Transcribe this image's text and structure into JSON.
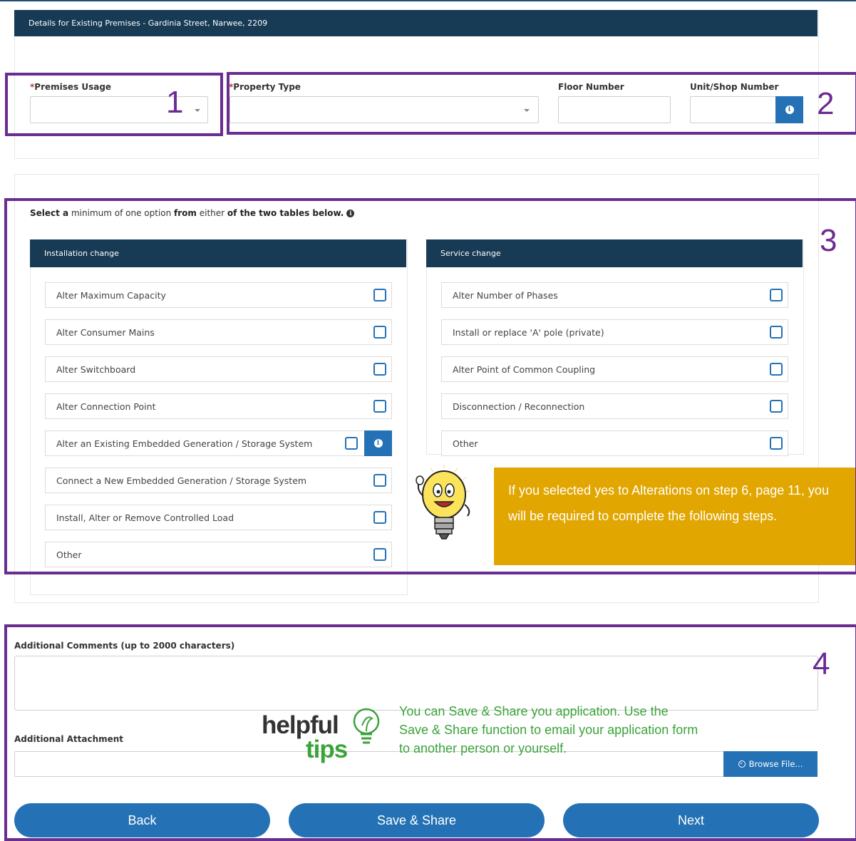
{
  "header": {
    "title": "Details for Existing Premises - Gardinia Street, Narwee, 2209"
  },
  "premises": {
    "usage_label": "Premises Usage",
    "property_type_label": "Property Type",
    "floor_label": "Floor Number",
    "unit_label": "Unit/Shop Number",
    "required_mark": "*"
  },
  "annotations": [
    "1",
    "2",
    "3",
    "4"
  ],
  "selection": {
    "instruction_parts": [
      "Select a",
      " minimum of one option ",
      "from",
      " either ",
      "of the two tables below."
    ],
    "info_glyph": "i"
  },
  "installation": {
    "title": "Installation change",
    "options": [
      "Alter Maximum Capacity",
      "Alter Consumer Mains",
      "Alter Switchboard",
      "Alter Connection Point",
      "Alter an Existing Embedded Generation / Storage System",
      "Connect a New Embedded Generation / Storage System",
      "Install, Alter or Remove Controlled Load",
      "Other"
    ]
  },
  "service": {
    "title": "Service change",
    "options": [
      "Alter Number of Phases",
      "Install or replace 'A' pole (private)",
      "Alter Point of Common Coupling",
      "Disconnection / Reconnection",
      "Other"
    ]
  },
  "callout": {
    "text": "If you selected yes to Alterations on step 6, page 11, you will be required to complete the following steps."
  },
  "comments": {
    "label": "Additional Comments (up to 2000 characters)"
  },
  "attachment": {
    "label": "Additional Attachment",
    "browse_label": "Browse File..."
  },
  "tips": {
    "word1": "helpful",
    "word2": "tips",
    "text": "You can Save & Share you application. Use the Save & Share function to email your application form to another person or yourself."
  },
  "buttons": {
    "back": "Back",
    "save_share": "Save & Share",
    "next": "Next"
  },
  "colors": {
    "header": "#173a55",
    "accent": "#2472b5",
    "annotation": "#6a2c91",
    "callout": "#e2a600",
    "tips_green": "#3aa33a"
  },
  "icons": {
    "info": "info-circle-icon",
    "dropdown": "chevron-down-icon",
    "bulb": "lightbulb-mascot-icon",
    "upload": "upload-circle-icon"
  }
}
